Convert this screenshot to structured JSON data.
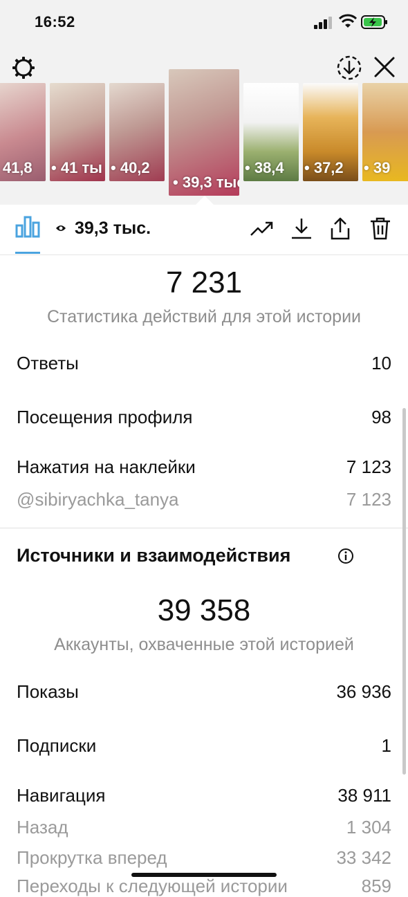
{
  "status_bar": {
    "time": "16:52"
  },
  "thumbnails": [
    {
      "count": "41,8",
      "bg": "linear-gradient(160deg,#e8d8d0 0%,#c98a90 55%,#9a5d6f 100%)"
    },
    {
      "count": "41 ты",
      "bg": "linear-gradient(160deg,#e6dccf 0%,#c7a59c 45%,#a0334c 100%)"
    },
    {
      "count": "40,2",
      "bg": "linear-gradient(160deg,#e4d9cf 0%,#bf9a94 45%,#a03c52 100%)"
    },
    {
      "count": "39,3 тыс.",
      "bg": "linear-gradient(160deg,#d8c8bb 0%,#c29a94 40%,#b43b5a 100%)",
      "selected": true
    },
    {
      "count": "38,4",
      "bg": "linear-gradient(180deg,#ffffff 0%,#f2f2f2 40%,#9bb06f 70%,#5d7b44 100%)"
    },
    {
      "count": "37,2",
      "bg": "linear-gradient(180deg,#fbfbfb 0%,#e7b45a 35%,#c98a2a 70%,#7a4e1a 100%)"
    },
    {
      "count": "39",
      "bg": "linear-gradient(180deg,#e9d2a8 0%,#d89a52 50%,#e8b820 100%)"
    }
  ],
  "toolbar": {
    "views": "39,3 тыс.",
    "accent": "#4aa3df"
  },
  "actions": {
    "total": "7 231",
    "caption": "Статистика действий для этой истории",
    "rows": [
      {
        "label": "Ответы",
        "value": "10"
      },
      {
        "label": "Посещения профиля",
        "value": "98"
      },
      {
        "label": "Нажатия на наклейки",
        "value": "7 123"
      },
      {
        "label": "@sibiryachka_tanya",
        "value": "7 123"
      }
    ]
  },
  "discovery": {
    "title": "Источники и взаимодействия",
    "total": "39 358",
    "caption": "Аккаунты, охваченные этой историей",
    "rows": [
      {
        "label": "Показы",
        "value": "36 936"
      },
      {
        "label": "Подписки",
        "value": "1"
      },
      {
        "label": "Навигация",
        "value": "38 911"
      },
      {
        "label": "Назад",
        "value": "1 304"
      },
      {
        "label": "Прокрутка вперед",
        "value": "33 342"
      },
      {
        "label": "Переходы к следующей истории",
        "value": "859"
      }
    ]
  }
}
